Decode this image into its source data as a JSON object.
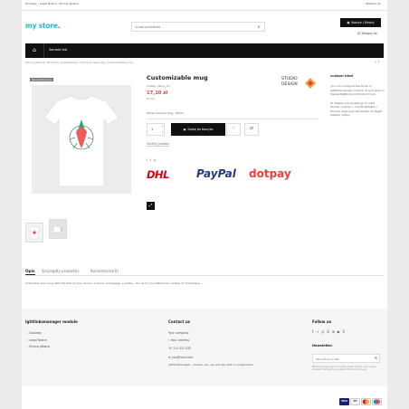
{
  "topbar": {
    "links": [
      "Dostawy",
      "Legal Notice",
      "Strona główna"
    ],
    "wishlist": "Wishlist (0)"
  },
  "header": {
    "logo_main": "my store",
    "search": {
      "placeholder": "Szukaj produktów"
    },
    "cart": "Koszyk / Empty",
    "login": "Zaloguj się"
  },
  "nav": {
    "items": [
      "Sample tab"
    ]
  },
  "breadcrumb": [
    "Strona główna",
    "Produkty przykładowe",
    "Home Accessories",
    "Customizable mug"
  ],
  "product": {
    "badge": "Nieopublikowane",
    "title": "Customizable mug",
    "reference": "Indeks: demo_14",
    "price": "17,10 zł",
    "tax": "Brutto",
    "short_desc": "White Ceramic Mug. 325ml",
    "quantity": "1",
    "add_to_cart": "Dodaj do koszyka",
    "brand_line1": "STUDIO",
    "brand_line2": "DESIGN",
    "share": [
      "f",
      "t",
      "p"
    ],
    "signature": "Seraftu_bladder",
    "carriers": [
      "DHL",
      "PayPal",
      "dotpay"
    ]
  },
  "side_block": {
    "title": "custom html",
    "text": "you can configure this block in ightlinksmaneks module. It is hooked in displayRightColumnProduct hook.\n\nTo disable and enable go to right banner module > Content/Pages > Product page and set hidden for Right sidebar option."
  },
  "tabs": [
    "Opis",
    "Szczegóły produktu",
    "Komentarze(0)"
  ],
  "description": "Customize your mug with the text of your choice. A mood, a message, a quote... It's up to you! Maximum number of characters: ---",
  "footer": {
    "col1": {
      "title": "Ightlinksmanager module",
      "items": [
        "Dostawy",
        "Legal Notice",
        "Strona główna"
      ]
    },
    "col2": {
      "title": "Contact us",
      "lines": [
        "Your company",
        "Your address",
        "111 222 333",
        "you@mail.com",
        "ightlinksbanager - module, you can put own text in configuration"
      ]
    },
    "col3": {
      "title": "Follow us",
      "social": [
        "f",
        "→",
        "◎",
        "G",
        "⊕",
        "▶",
        "V"
      ],
      "newsletter_title": "Newsletter",
      "email_placeholder": "Twój adres e-mail",
      "legal": "Możesz zrezygnować w każdej chwili. W tym celu należy odnaleźć szczegóły w naszej informacji prawnej."
    },
    "payment": [
      "VISA",
      "PP",
      "MC",
      "MC"
    ]
  },
  "colors": {
    "accent": "#e8413c",
    "logo_blue": "#24b9d7"
  }
}
